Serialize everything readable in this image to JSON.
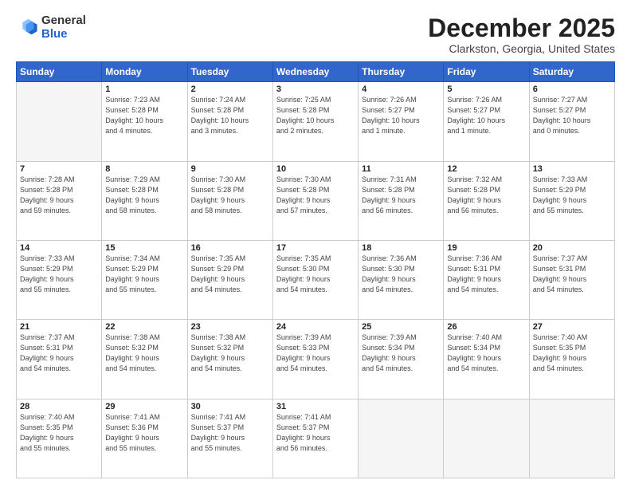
{
  "logo": {
    "general": "General",
    "blue": "Blue"
  },
  "header": {
    "month": "December 2025",
    "location": "Clarkston, Georgia, United States"
  },
  "weekdays": [
    "Sunday",
    "Monday",
    "Tuesday",
    "Wednesday",
    "Thursday",
    "Friday",
    "Saturday"
  ],
  "weeks": [
    [
      {
        "day": "",
        "info": ""
      },
      {
        "day": "1",
        "info": "Sunrise: 7:23 AM\nSunset: 5:28 PM\nDaylight: 10 hours\nand 4 minutes."
      },
      {
        "day": "2",
        "info": "Sunrise: 7:24 AM\nSunset: 5:28 PM\nDaylight: 10 hours\nand 3 minutes."
      },
      {
        "day": "3",
        "info": "Sunrise: 7:25 AM\nSunset: 5:28 PM\nDaylight: 10 hours\nand 2 minutes."
      },
      {
        "day": "4",
        "info": "Sunrise: 7:26 AM\nSunset: 5:27 PM\nDaylight: 10 hours\nand 1 minute."
      },
      {
        "day": "5",
        "info": "Sunrise: 7:26 AM\nSunset: 5:27 PM\nDaylight: 10 hours\nand 1 minute."
      },
      {
        "day": "6",
        "info": "Sunrise: 7:27 AM\nSunset: 5:27 PM\nDaylight: 10 hours\nand 0 minutes."
      }
    ],
    [
      {
        "day": "7",
        "info": "Sunrise: 7:28 AM\nSunset: 5:28 PM\nDaylight: 9 hours\nand 59 minutes."
      },
      {
        "day": "8",
        "info": "Sunrise: 7:29 AM\nSunset: 5:28 PM\nDaylight: 9 hours\nand 58 minutes."
      },
      {
        "day": "9",
        "info": "Sunrise: 7:30 AM\nSunset: 5:28 PM\nDaylight: 9 hours\nand 58 minutes."
      },
      {
        "day": "10",
        "info": "Sunrise: 7:30 AM\nSunset: 5:28 PM\nDaylight: 9 hours\nand 57 minutes."
      },
      {
        "day": "11",
        "info": "Sunrise: 7:31 AM\nSunset: 5:28 PM\nDaylight: 9 hours\nand 56 minutes."
      },
      {
        "day": "12",
        "info": "Sunrise: 7:32 AM\nSunset: 5:28 PM\nDaylight: 9 hours\nand 56 minutes."
      },
      {
        "day": "13",
        "info": "Sunrise: 7:33 AM\nSunset: 5:29 PM\nDaylight: 9 hours\nand 55 minutes."
      }
    ],
    [
      {
        "day": "14",
        "info": "Sunrise: 7:33 AM\nSunset: 5:29 PM\nDaylight: 9 hours\nand 55 minutes."
      },
      {
        "day": "15",
        "info": "Sunrise: 7:34 AM\nSunset: 5:29 PM\nDaylight: 9 hours\nand 55 minutes."
      },
      {
        "day": "16",
        "info": "Sunrise: 7:35 AM\nSunset: 5:29 PM\nDaylight: 9 hours\nand 54 minutes."
      },
      {
        "day": "17",
        "info": "Sunrise: 7:35 AM\nSunset: 5:30 PM\nDaylight: 9 hours\nand 54 minutes."
      },
      {
        "day": "18",
        "info": "Sunrise: 7:36 AM\nSunset: 5:30 PM\nDaylight: 9 hours\nand 54 minutes."
      },
      {
        "day": "19",
        "info": "Sunrise: 7:36 AM\nSunset: 5:31 PM\nDaylight: 9 hours\nand 54 minutes."
      },
      {
        "day": "20",
        "info": "Sunrise: 7:37 AM\nSunset: 5:31 PM\nDaylight: 9 hours\nand 54 minutes."
      }
    ],
    [
      {
        "day": "21",
        "info": "Sunrise: 7:37 AM\nSunset: 5:31 PM\nDaylight: 9 hours\nand 54 minutes."
      },
      {
        "day": "22",
        "info": "Sunrise: 7:38 AM\nSunset: 5:32 PM\nDaylight: 9 hours\nand 54 minutes."
      },
      {
        "day": "23",
        "info": "Sunrise: 7:38 AM\nSunset: 5:32 PM\nDaylight: 9 hours\nand 54 minutes."
      },
      {
        "day": "24",
        "info": "Sunrise: 7:39 AM\nSunset: 5:33 PM\nDaylight: 9 hours\nand 54 minutes."
      },
      {
        "day": "25",
        "info": "Sunrise: 7:39 AM\nSunset: 5:34 PM\nDaylight: 9 hours\nand 54 minutes."
      },
      {
        "day": "26",
        "info": "Sunrise: 7:40 AM\nSunset: 5:34 PM\nDaylight: 9 hours\nand 54 minutes."
      },
      {
        "day": "27",
        "info": "Sunrise: 7:40 AM\nSunset: 5:35 PM\nDaylight: 9 hours\nand 54 minutes."
      }
    ],
    [
      {
        "day": "28",
        "info": "Sunrise: 7:40 AM\nSunset: 5:35 PM\nDaylight: 9 hours\nand 55 minutes."
      },
      {
        "day": "29",
        "info": "Sunrise: 7:41 AM\nSunset: 5:36 PM\nDaylight: 9 hours\nand 55 minutes."
      },
      {
        "day": "30",
        "info": "Sunrise: 7:41 AM\nSunset: 5:37 PM\nDaylight: 9 hours\nand 55 minutes."
      },
      {
        "day": "31",
        "info": "Sunrise: 7:41 AM\nSunset: 5:37 PM\nDaylight: 9 hours\nand 56 minutes."
      },
      {
        "day": "",
        "info": ""
      },
      {
        "day": "",
        "info": ""
      },
      {
        "day": "",
        "info": ""
      }
    ]
  ]
}
